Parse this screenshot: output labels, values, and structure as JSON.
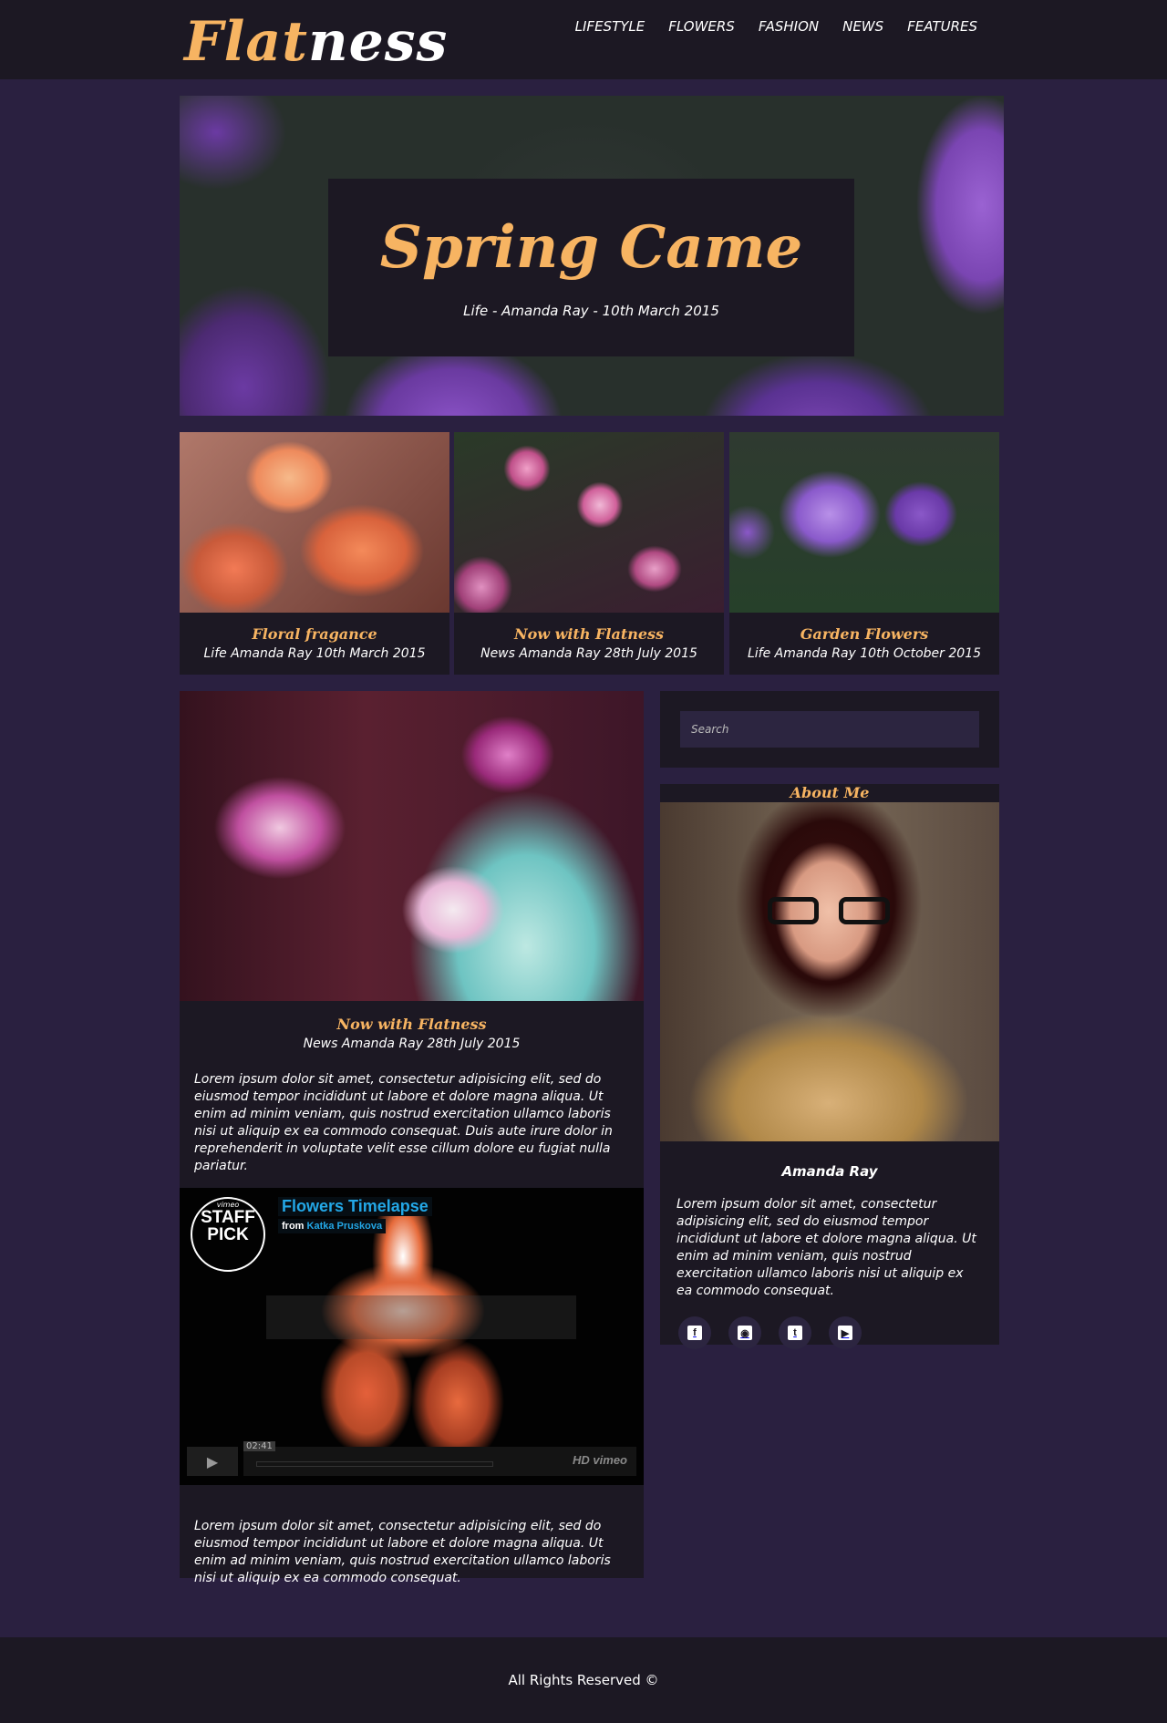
{
  "header": {
    "logo_part1": "Flat",
    "logo_part2": "ness",
    "nav": [
      "LIFESTYLE",
      "FLOWERS",
      "FASHION",
      "NEWS",
      "FEATURES"
    ]
  },
  "hero": {
    "title": "Spring Came",
    "meta": "Life - Amanda Ray - 10th March 2015"
  },
  "cards": [
    {
      "title": "Floral fragance",
      "meta": "Life Amanda Ray 10th March 2015"
    },
    {
      "title": "Now with Flatness",
      "meta": "News Amanda Ray 28th July 2015"
    },
    {
      "title": "Garden Flowers",
      "meta": "Life Amanda Ray 10th October 2015"
    }
  ],
  "post": {
    "title": "Now with Flatness",
    "meta": "News Amanda Ray 28th July 2015",
    "text": "Lorem ipsum dolor sit amet, consectetur adipisicing elit, sed do eiusmod tempor incididunt ut labore et dolore magna aliqua. Ut enim ad minim veniam, quis nostrud exercitation ullamco laboris nisi ut aliquip ex ea commodo consequat. Duis aute irure dolor in reprehenderit in voluptate velit esse cillum dolore eu fugiat nulla pariatur.",
    "video": {
      "badge_top": "vimeo",
      "badge_main": "STAFF PICK",
      "title": "Flowers Timelapse",
      "from_label": "from",
      "author": "Katka Pruskova",
      "time": "02:41",
      "controls_right": "HD  vimeo"
    },
    "text2": "Lorem ipsum dolor sit amet, consectetur adipisicing elit, sed do eiusmod tempor incididunt ut labore et dolore magna aliqua. Ut enim ad minim veniam, quis nostrud exercitation ullamco laboris nisi ut aliquip ex ea commodo consequat."
  },
  "sidebar": {
    "search_placeholder": "Search",
    "about_heading": "About Me",
    "about_name": "Amanda Ray",
    "about_text": "Lorem ipsum dolor sit amet, consectetur adipisicing elit, sed do eiusmod tempor incididunt ut labore et dolore magna aliqua. Ut enim ad minim veniam, quis nostrud exercitation ullamco laboris nisi ut aliquip ex ea commodo consequat.",
    "socials": [
      "facebook-icon",
      "instagram-icon",
      "twitter-icon",
      "youtube-icon"
    ]
  },
  "footer": {
    "text": "All Rights Reserved ©"
  },
  "colors": {
    "accent": "#f7b462",
    "bg": "#2a2040",
    "panel": "#1c1823"
  }
}
